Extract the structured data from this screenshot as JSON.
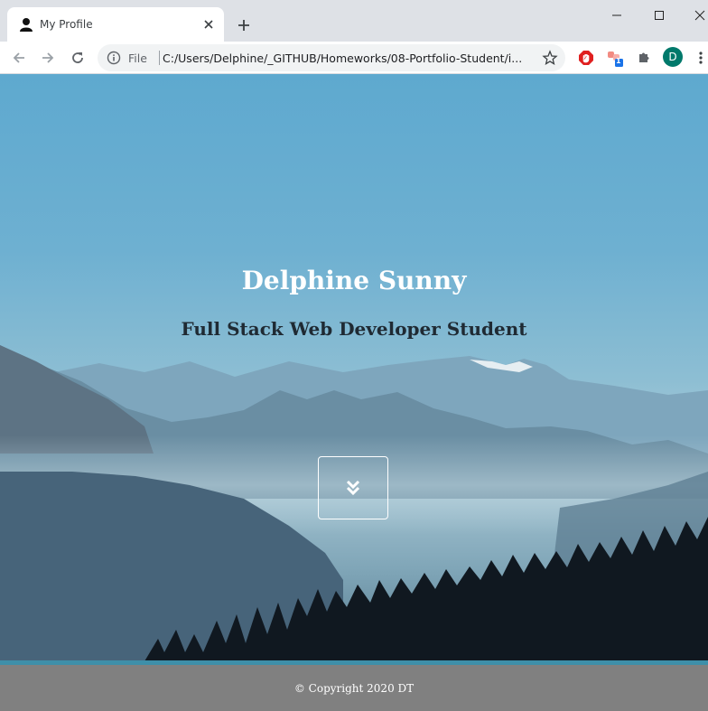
{
  "browser": {
    "tab_title": "My Profile",
    "url_scheme_label": "File",
    "url": "C:/Users/Delphine/_GITHUB/Homeworks/08-Portfolio-Student/i...",
    "extension_badge": "1",
    "profile_initial": "D"
  },
  "hero": {
    "name": "Delphine Sunny",
    "tagline": "Full Stack Web Developer Student",
    "scroll_icon": "chevron-double-down-icon"
  },
  "footer": {
    "copyright": "© Copyright 2020 DT"
  },
  "colors": {
    "chrome_bg": "#dee1e6",
    "footer_bg": "#808080",
    "accent": "#3e8fa9",
    "avatar": "#00796b"
  }
}
